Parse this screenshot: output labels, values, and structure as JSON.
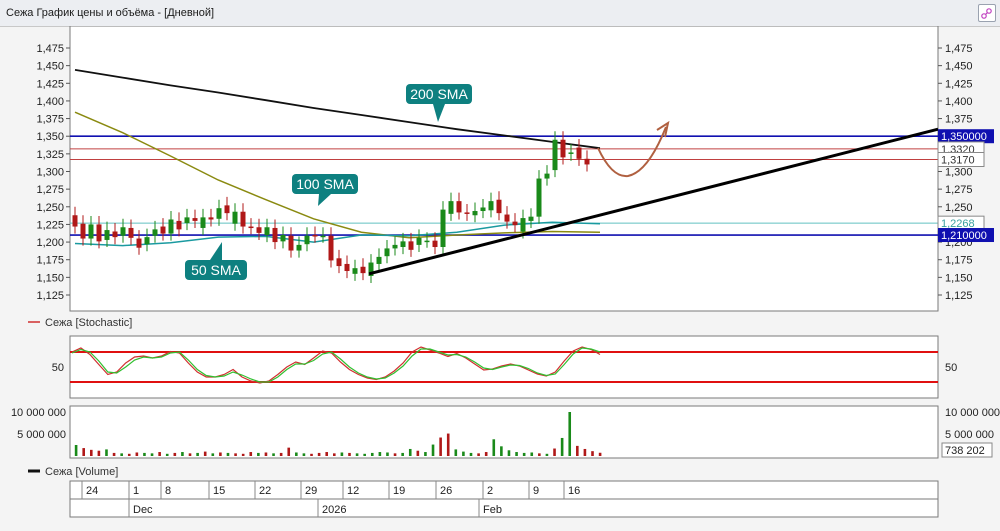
{
  "window": {
    "title": "Сежа График цены и объёма - [Дневной]"
  },
  "colors": {
    "up": "#1a8a1a",
    "down": "#b01818",
    "sma200": "#111111",
    "sma100": "#8a8a10",
    "sma50": "#1a9aa0",
    "resistance": "#1010b0",
    "trend": "#000000",
    "hline": "#c04040",
    "stoch_k": "#d03030",
    "stoch_d": "#30c030",
    "stoch_band": "#e01010",
    "callout_bg": "#0e8080",
    "forecast": "#b06040"
  },
  "chart_data": [
    {
      "type": "candlestick",
      "title": "",
      "ylim": [
        1.11,
        1.48
      ],
      "ytick_labels": [
        "1,125",
        "1,150",
        "1,175",
        "1,200",
        "1,225",
        "1,250",
        "1,275",
        "1,300",
        "1,325",
        "1,350",
        "1,375",
        "1,400",
        "1,425",
        "1,450",
        "1,475"
      ],
      "candles": [
        {
          "o": 1.238,
          "c": 1.222
        },
        {
          "o": 1.226,
          "c": 1.205
        },
        {
          "o": 1.205,
          "c": 1.225
        },
        {
          "o": 1.225,
          "c": 1.201
        },
        {
          "o": 1.203,
          "c": 1.217
        },
        {
          "o": 1.215,
          "c": 1.207
        },
        {
          "o": 1.209,
          "c": 1.221
        },
        {
          "o": 1.22,
          "c": 1.206
        },
        {
          "o": 1.205,
          "c": 1.192
        },
        {
          "o": 1.197,
          "c": 1.207
        },
        {
          "o": 1.209,
          "c": 1.218
        },
        {
          "o": 1.222,
          "c": 1.212
        },
        {
          "o": 1.212,
          "c": 1.232
        },
        {
          "o": 1.23,
          "c": 1.218
        },
        {
          "o": 1.227,
          "c": 1.235
        },
        {
          "o": 1.234,
          "c": 1.23
        },
        {
          "o": 1.22,
          "c": 1.235
        },
        {
          "o": 1.235,
          "c": 1.232
        },
        {
          "o": 1.233,
          "c": 1.248
        },
        {
          "o": 1.252,
          "c": 1.241
        },
        {
          "o": 1.226,
          "c": 1.243
        },
        {
          "o": 1.243,
          "c": 1.222
        },
        {
          "o": 1.222,
          "c": 1.221
        },
        {
          "o": 1.221,
          "c": 1.213
        },
        {
          "o": 1.21,
          "c": 1.221
        },
        {
          "o": 1.22,
          "c": 1.2
        },
        {
          "o": 1.201,
          "c": 1.21
        },
        {
          "o": 1.209,
          "c": 1.188
        },
        {
          "o": 1.188,
          "c": 1.196
        },
        {
          "o": 1.197,
          "c": 1.209
        },
        {
          "o": 1.21,
          "c": 1.209
        },
        {
          "o": 1.209,
          "c": 1.209
        },
        {
          "o": 1.209,
          "c": 1.174
        },
        {
          "o": 1.177,
          "c": 1.166
        },
        {
          "o": 1.169,
          "c": 1.159
        },
        {
          "o": 1.155,
          "c": 1.163
        },
        {
          "o": 1.165,
          "c": 1.156
        },
        {
          "o": 1.152,
          "c": 1.171
        },
        {
          "o": 1.169,
          "c": 1.179
        },
        {
          "o": 1.18,
          "c": 1.191
        },
        {
          "o": 1.191,
          "c": 1.196
        },
        {
          "o": 1.193,
          "c": 1.201
        },
        {
          "o": 1.201,
          "c": 1.189
        },
        {
          "o": 1.196,
          "c": 1.206
        },
        {
          "o": 1.202,
          "c": 1.202
        },
        {
          "o": 1.202,
          "c": 1.193
        },
        {
          "o": 1.193,
          "c": 1.246
        },
        {
          "o": 1.24,
          "c": 1.258
        },
        {
          "o": 1.258,
          "c": 1.242
        },
        {
          "o": 1.242,
          "c": 1.24
        },
        {
          "o": 1.238,
          "c": 1.244
        },
        {
          "o": 1.244,
          "c": 1.249
        },
        {
          "o": 1.245,
          "c": 1.258
        },
        {
          "o": 1.26,
          "c": 1.241
        },
        {
          "o": 1.239,
          "c": 1.229
        },
        {
          "o": 1.229,
          "c": 1.224
        },
        {
          "o": 1.215,
          "c": 1.234
        },
        {
          "o": 1.23,
          "c": 1.236
        },
        {
          "o": 1.236,
          "c": 1.29
        },
        {
          "o": 1.29,
          "c": 1.297
        },
        {
          "o": 1.302,
          "c": 1.345
        },
        {
          "o": 1.345,
          "c": 1.32
        },
        {
          "o": 1.325,
          "c": 1.327
        },
        {
          "o": 1.334,
          "c": 1.318
        },
        {
          "o": 1.318,
          "c": 1.31
        }
      ],
      "horizontal_levels": [
        {
          "value": 1.35,
          "label": "1,350000",
          "kind": "resistance"
        },
        {
          "value": 1.332,
          "label": "1,3320",
          "kind": "price"
        },
        {
          "value": 1.317,
          "label": "1,3170",
          "kind": "price"
        },
        {
          "value": 1.2268,
          "label": "1,2268",
          "kind": "price"
        },
        {
          "value": 1.21,
          "label": "1,210000",
          "kind": "support"
        }
      ],
      "moving_averages": [
        {
          "name": "200 SMA",
          "values": [
            1.444,
            1.433,
            1.422,
            1.412,
            1.401,
            1.39,
            1.38,
            1.37,
            1.36,
            1.351,
            1.342,
            1.333
          ]
        },
        {
          "name": "100 SMA",
          "values": [
            1.384,
            1.355,
            1.322,
            1.288,
            1.26,
            1.233,
            1.214,
            1.206,
            1.21,
            1.213,
            1.215,
            1.214
          ]
        },
        {
          "name": "50 SMA",
          "values": [
            1.198,
            1.195,
            1.199,
            1.207,
            1.208,
            1.2,
            1.21,
            1.209,
            1.214,
            1.224,
            1.228,
            1.226
          ]
        }
      ],
      "trendline": {
        "from": {
          "index": 37,
          "value": 1.155
        },
        "to": {
          "index": 75,
          "value": 1.36
        }
      },
      "callouts": [
        "200 SMA",
        "100 SMA",
        "50 SMA"
      ]
    },
    {
      "type": "line",
      "title": "Сежа [Stochastic]",
      "ylim": [
        0,
        100
      ],
      "tick_label": "50",
      "bands": [
        80,
        20
      ],
      "series": [
        {
          "name": "%K",
          "values": [
            80,
            88,
            75,
            55,
            35,
            40,
            58,
            70,
            72,
            68,
            72,
            81,
            78,
            58,
            40,
            30,
            30,
            35,
            45,
            30,
            22,
            18,
            22,
            35,
            50,
            60,
            55,
            68,
            82,
            78,
            60,
            45,
            35,
            28,
            25,
            30,
            42,
            58,
            80,
            90,
            84,
            78,
            71,
            77,
            68,
            56,
            44,
            46,
            52,
            56,
            52,
            44,
            36,
            32,
            40,
            62,
            82,
            90,
            85,
            75
          ]
        },
        {
          "name": "%D",
          "values": [
            78,
            85,
            80,
            62,
            40,
            38,
            50,
            64,
            70,
            68,
            70,
            78,
            80,
            64,
            45,
            33,
            30,
            32,
            40,
            34,
            26,
            20,
            20,
            30,
            45,
            56,
            56,
            63,
            76,
            80,
            66,
            50,
            38,
            30,
            26,
            28,
            38,
            52,
            72,
            86,
            86,
            80,
            74,
            75,
            70,
            60,
            48,
            45,
            50,
            54,
            53,
            47,
            38,
            33,
            36,
            55,
            76,
            88,
            86,
            80
          ]
        }
      ]
    },
    {
      "type": "bar",
      "title": "Сежа [Volume]",
      "ylim": [
        0,
        10500000
      ],
      "ytick_labels": [
        "10 000 000",
        "5 000 000"
      ],
      "right_labels": [
        "10 000 000",
        "5 000 000",
        "738 202"
      ],
      "values": [
        2500000,
        1800000,
        1400000,
        1200000,
        1500000,
        700000,
        600000,
        500000,
        800000,
        700000,
        600000,
        900000,
        500000,
        700000,
        900000,
        600000,
        700000,
        1000000,
        600000,
        800000,
        700000,
        600000,
        500000,
        900000,
        700000,
        800000,
        600000,
        700000,
        1900000,
        800000,
        600000,
        500000,
        700000,
        900000,
        600000,
        800000,
        700000,
        600000,
        500000,
        700000,
        900000,
        800000,
        600000,
        700000,
        1600000,
        1200000,
        900000,
        2600000,
        4200000,
        5100000,
        1500000,
        1000000,
        700000,
        600000,
        900000,
        3800000,
        2200000,
        1300000,
        900000,
        700000,
        800000,
        600000,
        500000,
        1700000,
        4100000,
        10000000,
        2300000,
        1600000,
        1100000,
        738202
      ],
      "updown": [
        "u",
        "d",
        "d",
        "d",
        "u",
        "d",
        "u",
        "d",
        "d",
        "u",
        "u",
        "d",
        "u",
        "d",
        "u",
        "d",
        "u",
        "d",
        "u",
        "d",
        "u",
        "d",
        "d",
        "d",
        "u",
        "d",
        "u",
        "d",
        "d",
        "u",
        "u",
        "d",
        "d",
        "d",
        "d",
        "u",
        "d",
        "u",
        "u",
        "u",
        "u",
        "u",
        "d",
        "u",
        "u",
        "d",
        "u",
        "u",
        "d",
        "d",
        "u",
        "u",
        "u",
        "d",
        "d",
        "u",
        "u",
        "u",
        "u",
        "u",
        "u",
        "d",
        "u",
        "d",
        "u",
        "u",
        "d",
        "d",
        "d",
        "d"
      ]
    }
  ],
  "xaxis": {
    "days": [
      "24",
      "1",
      "8",
      "15",
      "22",
      "29",
      "12",
      "19",
      "26",
      "2",
      "9",
      "16"
    ],
    "months": [
      "Dec",
      "2026",
      "Feb"
    ]
  }
}
